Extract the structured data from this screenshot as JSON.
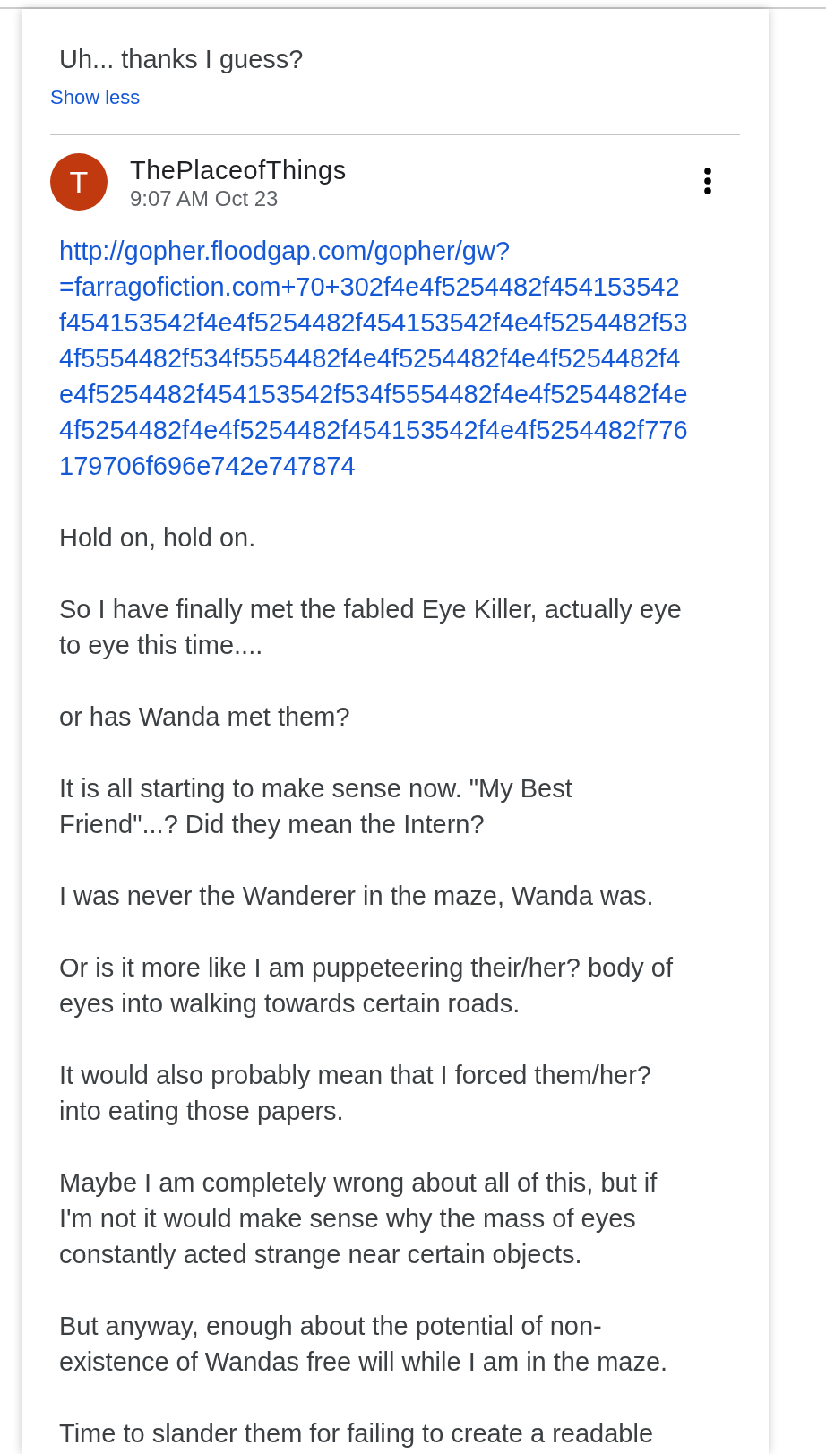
{
  "previous_comment": {
    "text": "Uh... thanks I guess?",
    "toggle_link": "Show less"
  },
  "comment": {
    "author": {
      "initial": "T",
      "name": "ThePlaceofThings"
    },
    "timestamp": "9:07 AM Oct 23",
    "body": [
      {
        "kind": "link",
        "lines": [
          "http://gopher.floodgap.com/gopher/gw?",
          "=farragofiction.com+70+302f4e4f5254482f454153542",
          "f454153542f4e4f5254482f454153542f4e4f5254482f53",
          "4f5554482f534f5554482f4e4f5254482f4e4f5254482f4",
          "e4f5254482f454153542f534f5554482f4e4f5254482f4e",
          "4f5254482f4e4f5254482f454153542f4e4f5254482f776",
          "179706f696e742e747874"
        ]
      },
      {
        "kind": "text",
        "text": "Hold on, hold on."
      },
      {
        "kind": "text",
        "text": "So I have finally met the fabled Eye Killer, actually eye to eye this time...."
      },
      {
        "kind": "text",
        "text": "or has Wanda met them?"
      },
      {
        "kind": "text",
        "text": "It is all starting to make sense now. \"My Best Friend\"...? Did they mean the Intern?"
      },
      {
        "kind": "text",
        "text": "I was never the Wanderer in the maze, Wanda was."
      },
      {
        "kind": "text",
        "text": "Or is it more like I am puppeteering their/her? body of eyes into walking towards certain roads."
      },
      {
        "kind": "text",
        "text": "It would also probably mean that I forced them/her? into eating those papers."
      },
      {
        "kind": "text",
        "text": "Maybe I am completely wrong about all of this, but if I'm not it would make sense why the mass of eyes constantly acted strange near certain objects."
      },
      {
        "kind": "text",
        "text": "But anyway, enough about the potential of non-existence of Wandas free will while I am in the maze."
      },
      {
        "kind": "text",
        "text": "Time to slander them for failing to create a readable"
      }
    ]
  }
}
